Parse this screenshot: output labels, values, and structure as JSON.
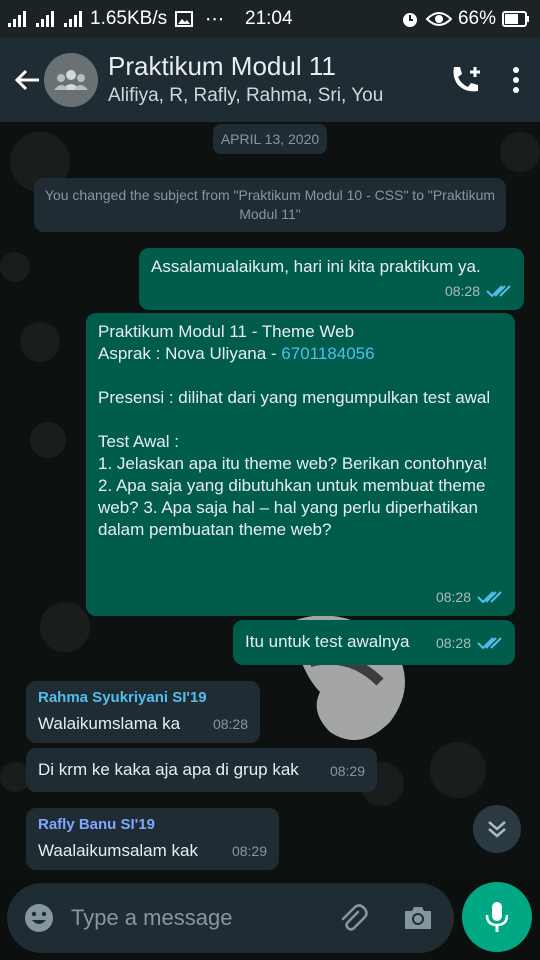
{
  "status_bar": {
    "network_speed": "1.65KB/s",
    "time": "21:04",
    "battery": "66%",
    "more": "⋯"
  },
  "header": {
    "title": "Praktikum Modul 11",
    "subtitle": "Alifiya, R, Rafly, Rahma, Sri, You"
  },
  "chat": {
    "date_chip": "APRIL 13, 2020",
    "system_message": "You changed the subject from \"Praktikum Modul 10 - CSS\" to \"Praktikum Modul 11\"",
    "messages": [
      {
        "direction": "out",
        "text": "Assalamualaikum, hari ini kita praktikum ya.",
        "time": "08:28",
        "read": true
      },
      {
        "direction": "out",
        "line1": "Praktikum Modul 11 - Theme Web",
        "line2_prefix": "Asprak : Nova Uliyana - ",
        "phone": "6701184056",
        "para2": "Presensi : dilihat dari yang mengumpulkan test awal",
        "para3": "Test Awal :",
        "para4": "1. Jelaskan apa itu theme web? Berikan contohnya!",
        "para5": "2. Apa saja yang dibutuhkan untuk membuat theme web? 3. Apa saja hal – hal yang perlu diperhatikan dalam pembuatan theme web?",
        "time": "08:28",
        "read": true
      },
      {
        "direction": "out",
        "text": "Itu untuk test awalnya",
        "time": "08:28",
        "read": true
      },
      {
        "direction": "in",
        "sender": "Rahma Syukriyani SI'19",
        "sender_color": "#53bdeb",
        "text": "Walaikumslama ka",
        "time": "08:28"
      },
      {
        "direction": "in",
        "text": "Di krm ke kaka aja apa di grup kak",
        "time": "08:29"
      },
      {
        "direction": "in",
        "sender": "Rafly Banu SI'19",
        "sender_color": "#7fa7ff",
        "text": "Waalaikumsalam kak",
        "time": "08:29"
      }
    ]
  },
  "composer": {
    "placeholder": "Type a message"
  },
  "colors": {
    "accent": "#00a884",
    "outgoing_bubble": "#005c4b",
    "incoming_bubble": "#1f2c34",
    "read_ticks": "#53bdeb"
  }
}
